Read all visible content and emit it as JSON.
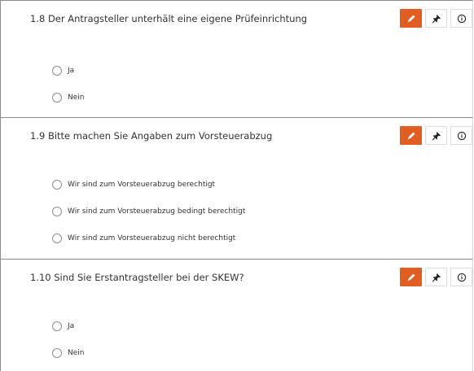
{
  "questions": [
    {
      "title": "1.8 Der Antragsteller unterhält eine eigene Prüfeinrichtung",
      "options": [
        "Ja",
        "Nein"
      ]
    },
    {
      "title": "1.9 Bitte machen Sie Angaben zum Vorsteuerabzug",
      "options": [
        "Wir sind zum Vorsteuerabzug berechtigt",
        "Wir sind zum Vorsteuerabzug bedingt berechtigt",
        "Wir sind zum Vorsteuerabzug nicht berechtigt"
      ]
    },
    {
      "title": "1.10 Sind Sie Erstantragsteller bei der SKEW?",
      "options": [
        "Ja",
        "Nein"
      ]
    }
  ],
  "action_icons": [
    "pencil-icon",
    "pin-icon",
    "info-icon"
  ],
  "colors": {
    "accent": "#e15d22",
    "text": "#333333",
    "border": "#8a8a8a"
  }
}
